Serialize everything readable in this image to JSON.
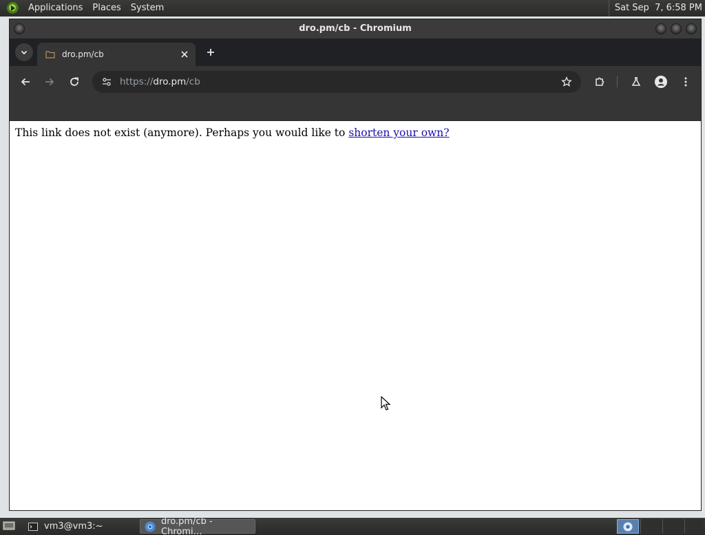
{
  "top_panel": {
    "menus": [
      "Applications",
      "Places",
      "System"
    ],
    "clock": "Sat Sep  7, 6:58 PM"
  },
  "window": {
    "title": "dro.pm/cb - Chromium"
  },
  "tab": {
    "title": "dro.pm/cb",
    "close_icon": "close-icon",
    "new_tab_icon": "plus-icon"
  },
  "omnibox": {
    "scheme": "https://",
    "host": "dro.pm",
    "path": "/cb"
  },
  "page": {
    "message": "This link does not exist (anymore). Perhaps you would like to ",
    "link_text": "shorten your own?"
  },
  "taskbar": {
    "tasks": [
      {
        "label": "vm3@vm3:~",
        "icon": "terminal-icon"
      },
      {
        "label": "dro.pm/cb - Chromi…",
        "icon": "chromium-icon"
      }
    ]
  },
  "colors": {
    "panel_bg": "#2b2c2a",
    "tabstrip_bg": "#202124",
    "toolbar_bg": "#353535",
    "link": "#1a0dab"
  }
}
